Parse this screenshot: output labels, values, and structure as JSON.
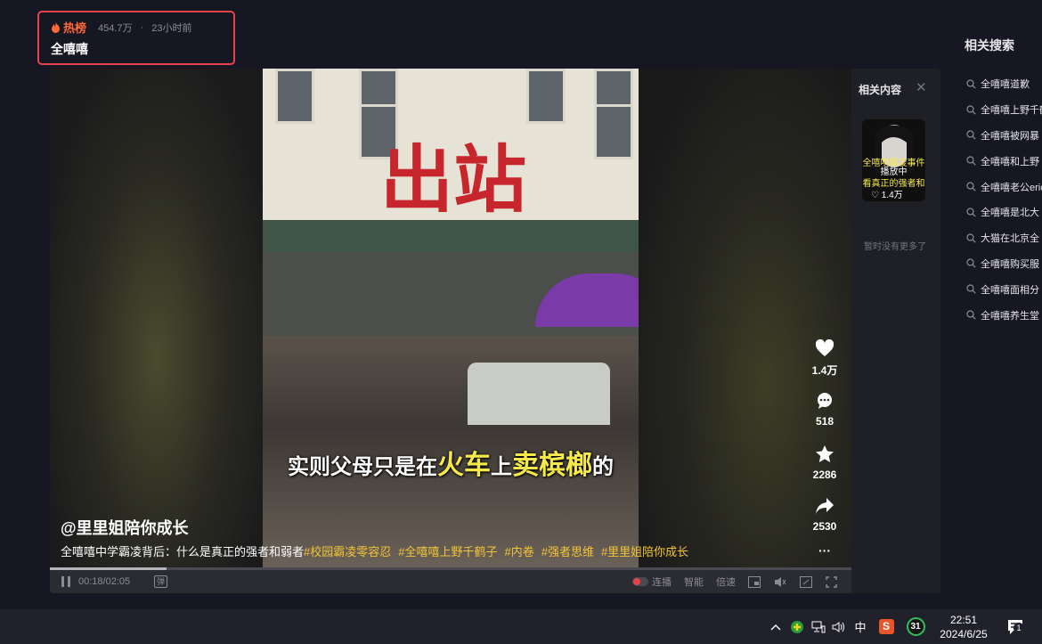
{
  "hot": {
    "tag": "热榜",
    "views": "454.7万",
    "separator": "·",
    "time_ago": "23小时前",
    "title": "全嘻嘻"
  },
  "video": {
    "sign_text": "出站",
    "subtitle_parts": [
      "实则父母只是在",
      "火车",
      "上",
      "卖槟榔",
      "的"
    ],
    "author": "@里里姐陪你成长",
    "description": "全嘻嘻中学霸凌背后：什么是真正的强者和弱者",
    "hashtags": [
      "#校园霸凌零容忍",
      "#全嘻嘻上野千鹤子",
      "#内卷",
      "#强者思维",
      "#里里姐陪你成长"
    ],
    "likes": "1.4万",
    "comments": "518",
    "favorites": "2286",
    "shares": "2530",
    "more": "···",
    "progress": 0.146
  },
  "controls": {
    "time": "00:18/02:05",
    "danmaku_icon": "弹",
    "autoplay": "连播",
    "smart": "智能",
    "speed": "倍速"
  },
  "related": {
    "title": "相关内容",
    "close": "✕",
    "thumb_caption1": "全嘻嘻霸凌事件",
    "thumb_playing": "播放中",
    "thumb_caption2": "看真正的强者和",
    "thumb_likes": "♡ 1.4万",
    "no_more": "暂时没有更多了"
  },
  "search": {
    "title": "相关搜索",
    "items": [
      "全嘻嘻道歉",
      "全嘻嘻上野千鹤子",
      "全嘻嘻被网暴",
      "全嘻嘻和上野",
      "全嘻嘻老公eric",
      "全嘻嘻是北大",
      "大猫在北京全",
      "全嘻嘻购买服",
      "全嘻嘻面相分",
      "全嘻嘻养生堂"
    ]
  },
  "taskbar": {
    "ime": "中",
    "badge": "31",
    "time": "22:51",
    "date": "2024/6/25",
    "notify_count": "1"
  },
  "colors": {
    "accent_red": "#e8434d",
    "hot_orange": "#ff6a36",
    "hashtag_yellow": "#f2c437",
    "subtitle_yellow": "#f6e94a"
  }
}
